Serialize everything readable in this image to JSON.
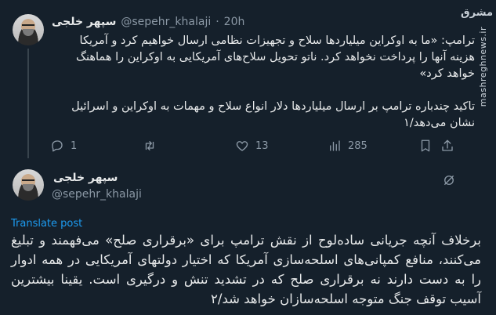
{
  "tweet1": {
    "author_name": "سپهر خلجی",
    "handle": "@sepehr_khalaji",
    "separator": "·",
    "time": "20h",
    "paragraphs": [
      "ترامپ: «ما به اوکراین میلیاردها سلاح و تجهیزات نظامی ارسال خواهیم کرد و آمریکا هزینه آنها را پرداخت نخواهد کرد. ناتو تحویل سلاح‌های آمریکایی به اوکراین را هماهنگ خواهد کرد»",
      "تاکید چندباره ترامپ بر ارسال میلیاردها دلار انواع سلاح و مهمات به اوکراین و اسرائیل نشان می‌دهد/۱"
    ],
    "actions": {
      "replies": "1",
      "retweets": "",
      "likes": "13",
      "views": "285"
    }
  },
  "tweet2": {
    "author_name": "سپهر خلجی",
    "handle": "@sepehr_khalaji",
    "translate_label": "Translate post",
    "body": "برخلاف آنچه جریانی ساده‌لوح از نقش ترامپ برای «برقراری صلح» می‌فهمند و تبلیغ می‌کنند، منافع کمپانی‌های اسلحه‌سازی آمریکا که اختیار دولتهای آمریکایی در همه ادوار را به دست دارند نه برقراری صلح که در تشدید تنش و درگیری است. یقینا بیشترین آسیب توقف جنگ متوجه اسلحه‌سازان خواهد شد/۲"
  },
  "watermark": {
    "logo": "مشرق",
    "text": "mashreghnews.ir"
  },
  "colors": {
    "background": "#15202b",
    "text": "#e7e9ea",
    "muted": "#8b98a5",
    "link": "#1d9bf0"
  }
}
